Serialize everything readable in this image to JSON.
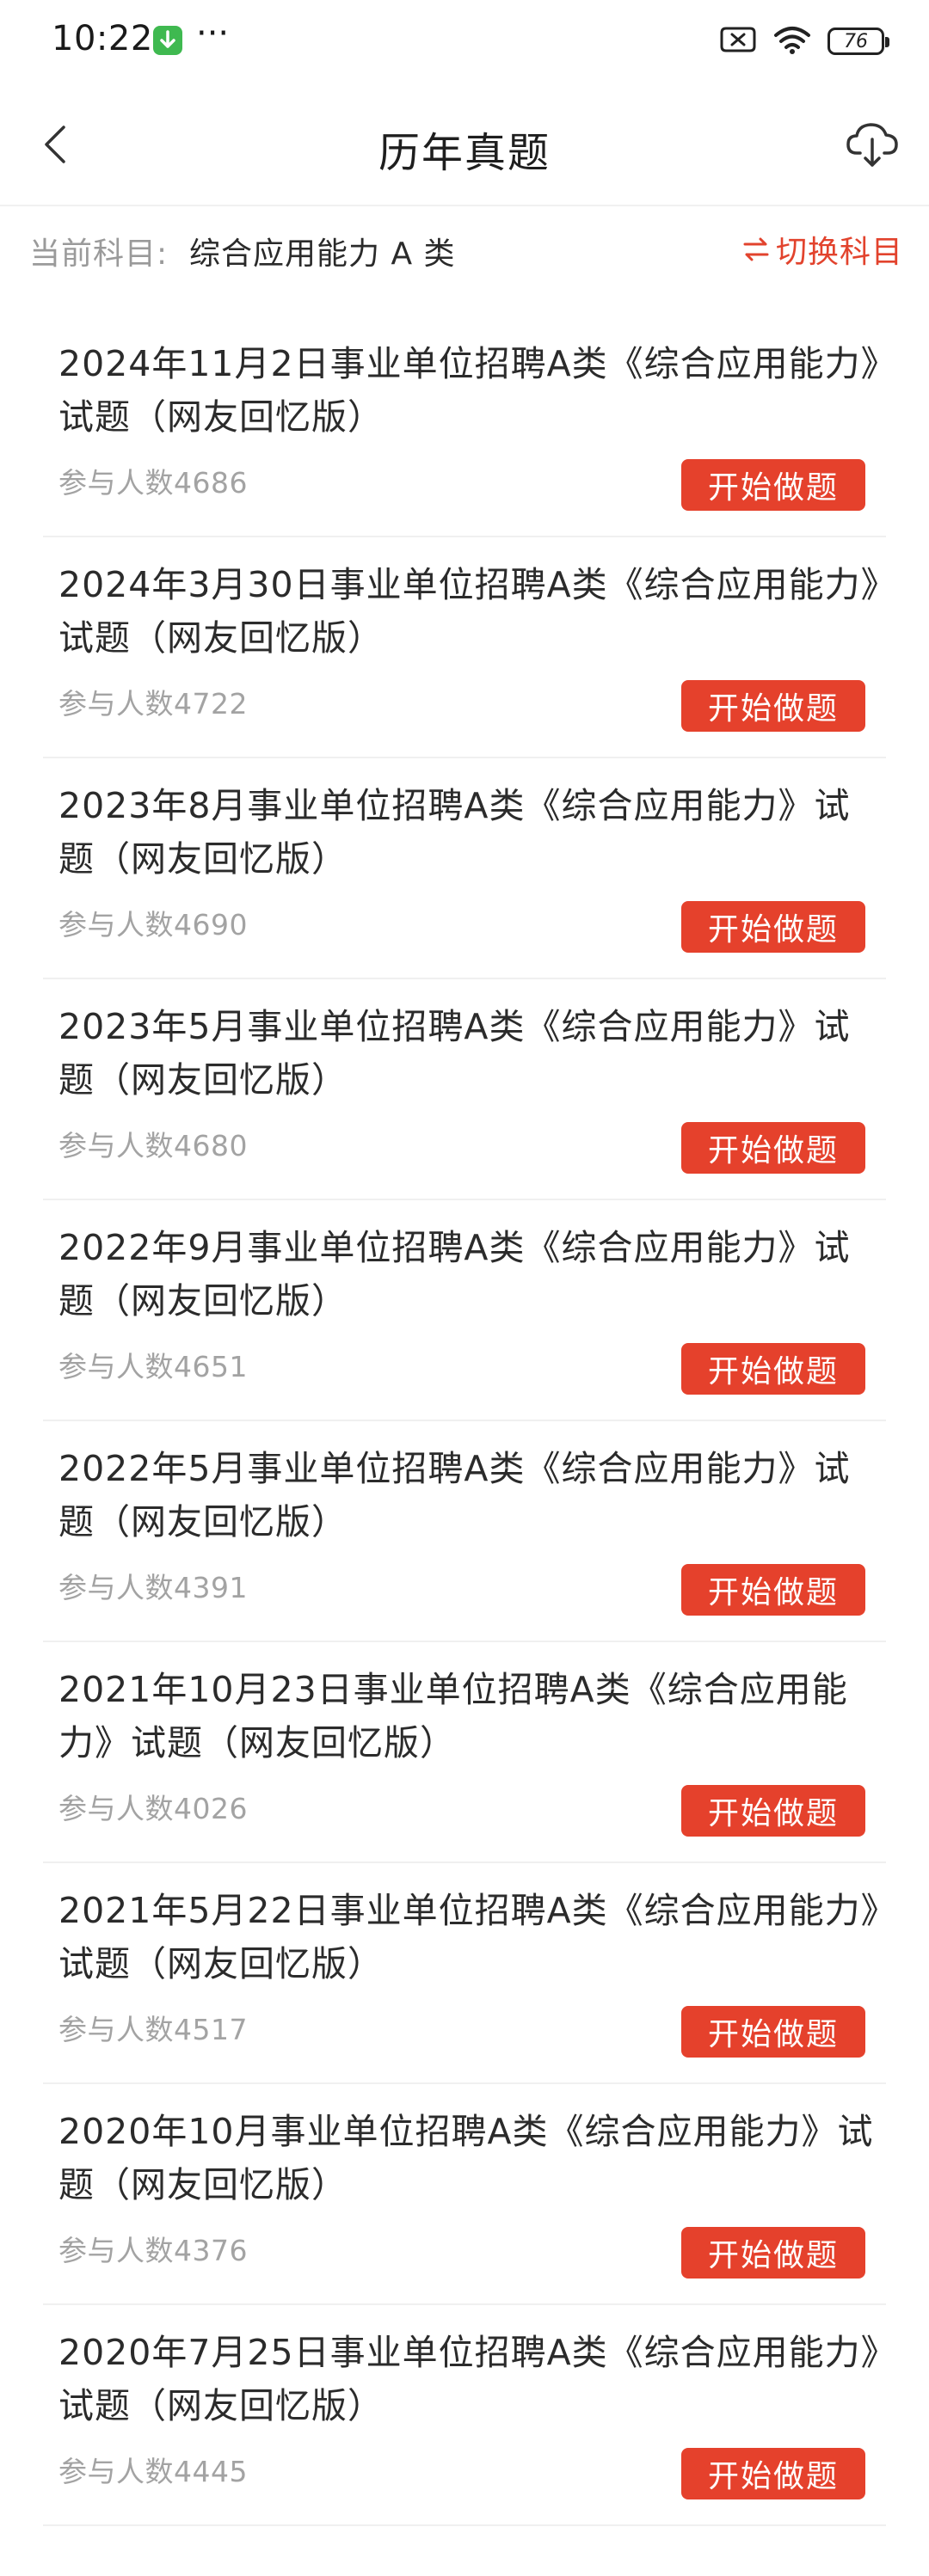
{
  "status_bar": {
    "time": "10:22",
    "more": "···",
    "battery": "76"
  },
  "header": {
    "title": "历年真题"
  },
  "subject": {
    "label": "当前科目:",
    "value": "综合应用能力 A 类",
    "switch_label": "切换科目"
  },
  "colors": {
    "accent": "#e5412c",
    "muted_text": "#a3a3a3"
  },
  "exams": [
    {
      "title": "2024年11月2日事业单位招聘A类《综合应用能力》试题（网友回忆版）",
      "participants": "参与人数4686",
      "button": "开始做题"
    },
    {
      "title": "2024年3月30日事业单位招聘A类《综合应用能力》试题（网友回忆版）",
      "participants": "参与人数4722",
      "button": "开始做题"
    },
    {
      "title": "2023年8月事业单位招聘A类《综合应用能力》试题（网友回忆版）",
      "participants": "参与人数4690",
      "button": "开始做题"
    },
    {
      "title": "2023年5月事业单位招聘A类《综合应用能力》试题（网友回忆版）",
      "participants": "参与人数4680",
      "button": "开始做题"
    },
    {
      "title": "2022年9月事业单位招聘A类《综合应用能力》试题（网友回忆版）",
      "participants": "参与人数4651",
      "button": "开始做题"
    },
    {
      "title": "2022年5月事业单位招聘A类《综合应用能力》试题（网友回忆版）",
      "participants": "参与人数4391",
      "button": "开始做题"
    },
    {
      "title": "2021年10月23日事业单位招聘A类《综合应用能力》试题（网友回忆版）",
      "participants": "参与人数4026",
      "button": "开始做题"
    },
    {
      "title": "2021年5月22日事业单位招聘A类《综合应用能力》试题（网友回忆版）",
      "participants": "参与人数4517",
      "button": "开始做题"
    },
    {
      "title": "2020年10月事业单位招聘A类《综合应用能力》试题（网友回忆版）",
      "participants": "参与人数4376",
      "button": "开始做题"
    },
    {
      "title": "2020年7月25日事业单位招聘A类《综合应用能力》试题（网友回忆版）",
      "participants": "参与人数4445",
      "button": "开始做题"
    }
  ]
}
